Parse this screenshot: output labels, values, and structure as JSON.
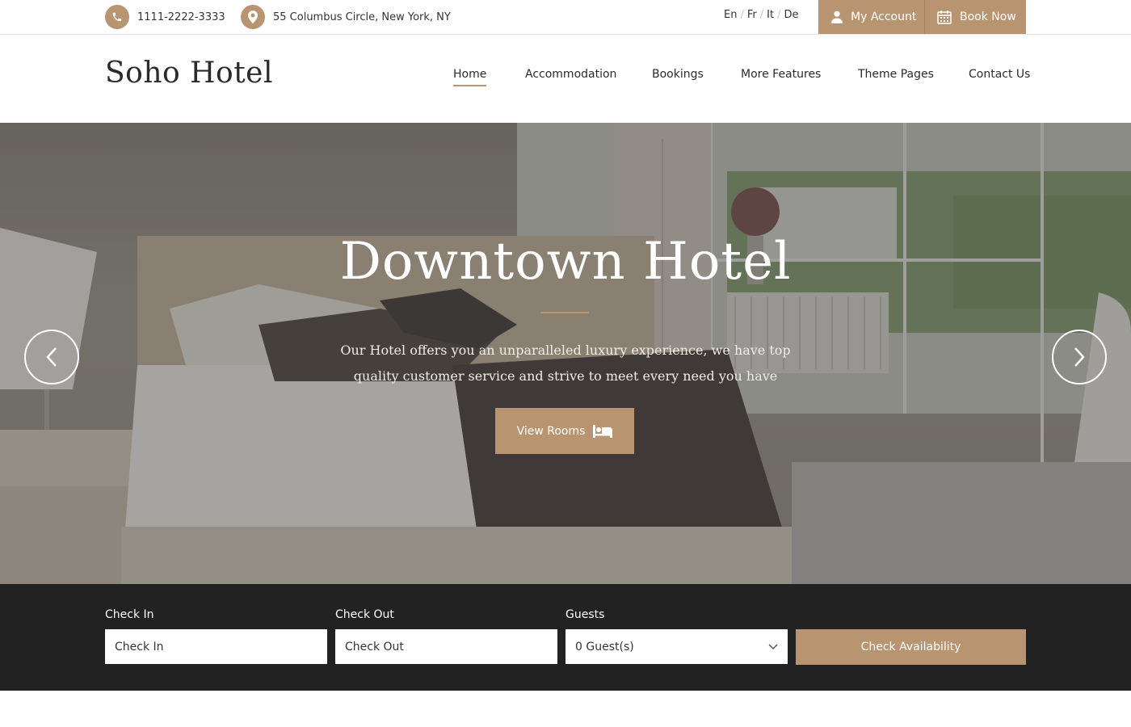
{
  "topbar": {
    "phone": "1111-2222-3333",
    "address": "55 Columbus Circle, New York, NY",
    "languages": [
      "En",
      "Fr",
      "It",
      "De"
    ],
    "account_label": "My Account",
    "book_label": "Book Now"
  },
  "header": {
    "logo": "Soho Hotel",
    "nav": [
      "Home",
      "Accommodation",
      "Bookings",
      "More Features",
      "Theme Pages",
      "Contact Us"
    ],
    "active_nav": "Home"
  },
  "hero": {
    "title": "Downtown Hotel",
    "subtitle": "Our Hotel offers you an unparalleled luxury experience, we have top quality customer service and strive to meet every need you have",
    "button_label": "View Rooms"
  },
  "booking": {
    "checkin_label": "Check In",
    "checkin_placeholder": "Check In",
    "checkout_label": "Check Out",
    "checkout_placeholder": "Check Out",
    "guests_label": "Guests",
    "guests_value": "0 Guest(s)",
    "submit_label": "Check Availability"
  },
  "colors": {
    "accent": "#b99470",
    "booking_bg": "#222222",
    "text_dark": "#2b2b2b"
  },
  "icons": {
    "phone": "phone-icon",
    "address": "map-marker-icon",
    "account": "user-icon",
    "book": "calendar-icon",
    "view_rooms": "bed-icon",
    "prev": "chevron-left-icon",
    "next": "chevron-right-icon",
    "select": "chevron-down-icon"
  }
}
